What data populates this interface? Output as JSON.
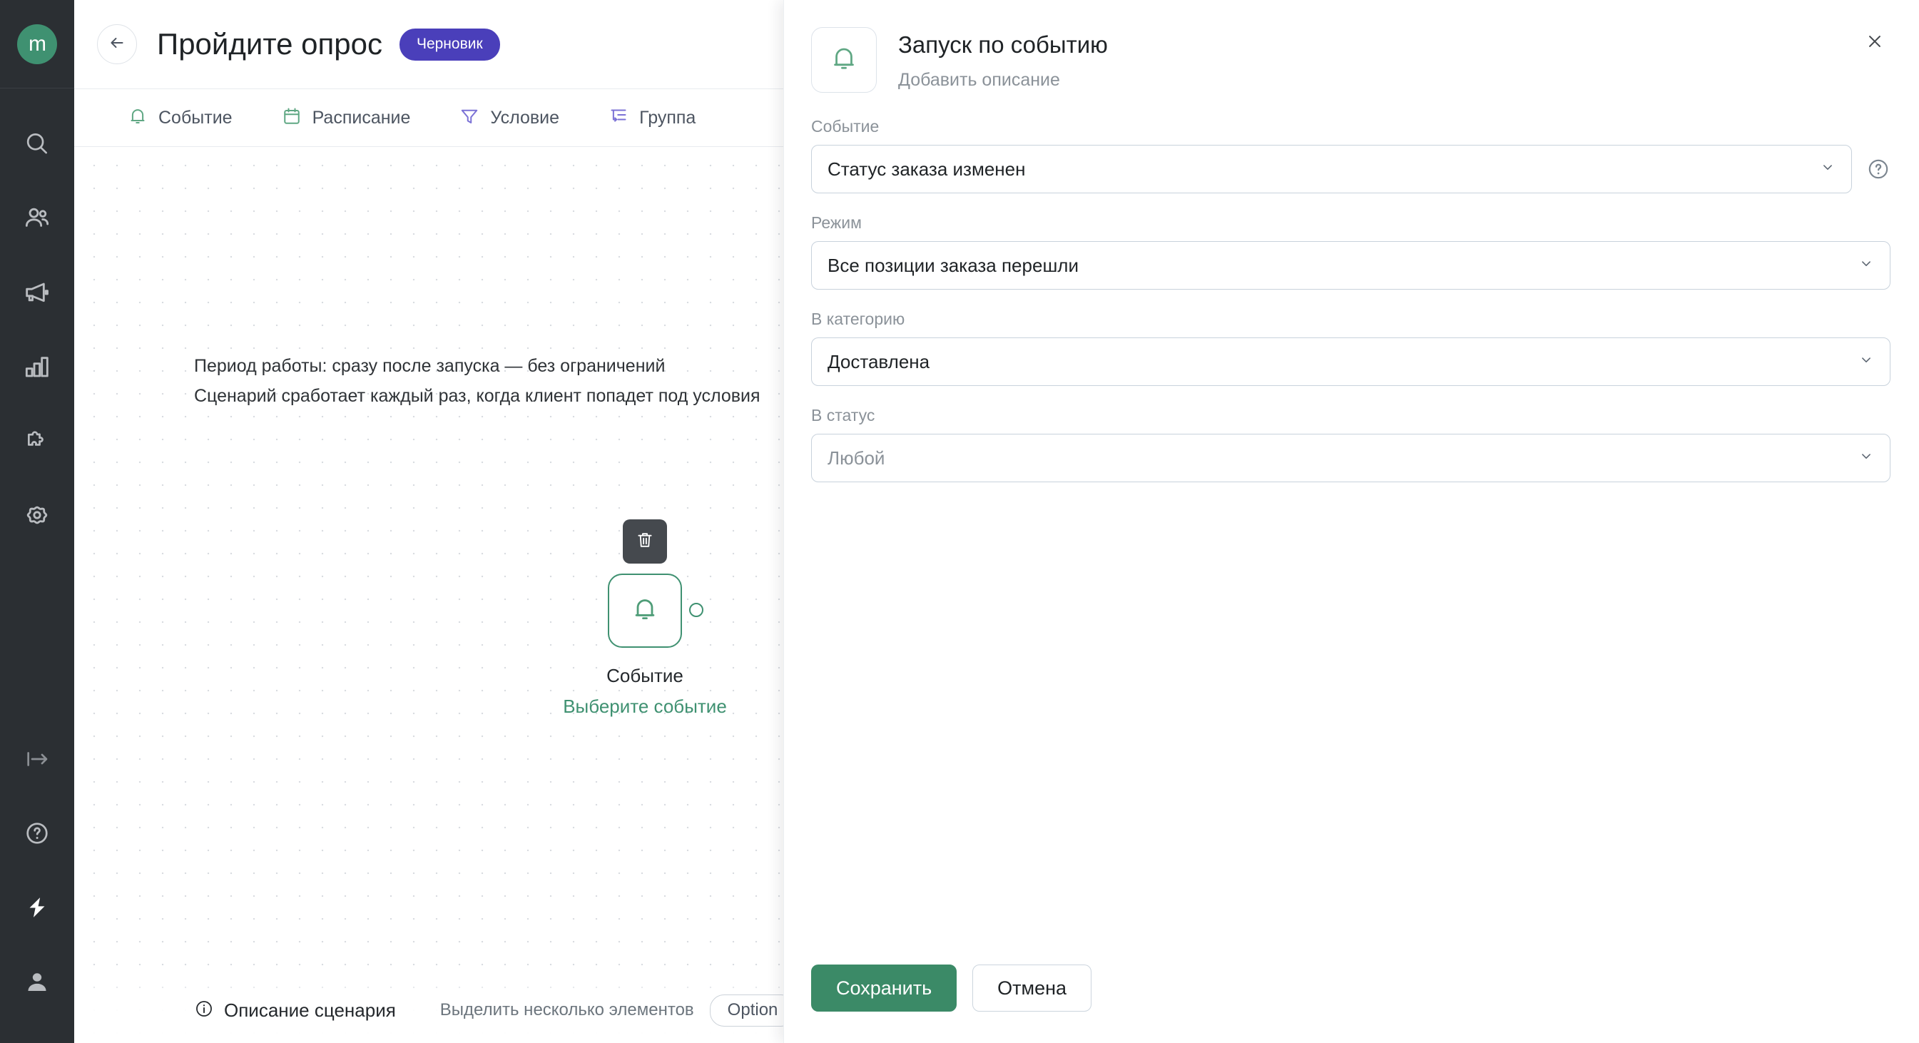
{
  "sidebar": {
    "logo_text": "m",
    "top_items": [
      {
        "icon": "search-icon",
        "name": "sidebar-item-search"
      },
      {
        "icon": "users-icon",
        "name": "sidebar-item-clients"
      },
      {
        "icon": "megaphone-icon",
        "name": "sidebar-item-campaigns"
      },
      {
        "icon": "bar-chart-icon",
        "name": "sidebar-item-analytics"
      },
      {
        "icon": "puzzle-icon",
        "name": "sidebar-item-integrations"
      },
      {
        "icon": "gear-icon",
        "name": "sidebar-item-settings"
      }
    ],
    "bottom_items": [
      {
        "icon": "collapse-arrow-icon",
        "name": "sidebar-item-collapse"
      },
      {
        "icon": "question-circle-icon",
        "name": "sidebar-item-help"
      },
      {
        "icon": "lightning-icon",
        "name": "sidebar-item-updates"
      },
      {
        "icon": "user-avatar-icon",
        "name": "sidebar-item-account"
      }
    ]
  },
  "header": {
    "back_icon": "arrow-left-icon",
    "title": "Пройдите опрос",
    "status_badge": "Черновик",
    "badge_color": "#4a3fba"
  },
  "tabs": [
    {
      "label": "Событие",
      "icon": "bell-icon",
      "color": "#5fa783"
    },
    {
      "label": "Расписание",
      "icon": "calendar-icon",
      "color": "#5fa783"
    },
    {
      "label": "Условие",
      "icon": "filter-icon",
      "color": "#7b72d6"
    },
    {
      "label": "Группа",
      "icon": "group-branch-icon",
      "color": "#7b72d6"
    }
  ],
  "canvas": {
    "note_line1": "Период работы: сразу после запуска — без ограничений",
    "note_line2": "Сценарий сработает каждый раз, когда клиент попадет под условия",
    "node": {
      "delete_icon": "trash-icon",
      "icon": "bell-icon",
      "title": "Событие",
      "action_link": "Выберите событие",
      "accent": "#3f9171"
    },
    "statusbar": {
      "info_icon": "info-circle-icon",
      "description_label": "Описание сценария",
      "hint": "Выделить несколько элементов",
      "key": "Option",
      "plus": "+"
    }
  },
  "panel": {
    "icon": "bell-icon",
    "title": "Запуск по событию",
    "subtitle": "Добавить описание",
    "close_icon": "close-icon",
    "fields": [
      {
        "label": "Событие",
        "value": "Статус заказа изменен",
        "name": "event-select",
        "is_placeholder": false,
        "has_help": true
      },
      {
        "label": "Режим",
        "value": "Все позиции заказа перешли",
        "name": "mode-select",
        "is_placeholder": false,
        "has_help": false
      },
      {
        "label": "В категорию",
        "value": "Доставлена",
        "name": "category-select",
        "is_placeholder": false,
        "has_help": false
      },
      {
        "label": "В статус",
        "value": "Любой",
        "name": "status-select",
        "is_placeholder": true,
        "has_help": false
      }
    ],
    "footer": {
      "save_label": "Сохранить",
      "cancel_label": "Отмена",
      "save_color": "#3b8a67"
    }
  }
}
